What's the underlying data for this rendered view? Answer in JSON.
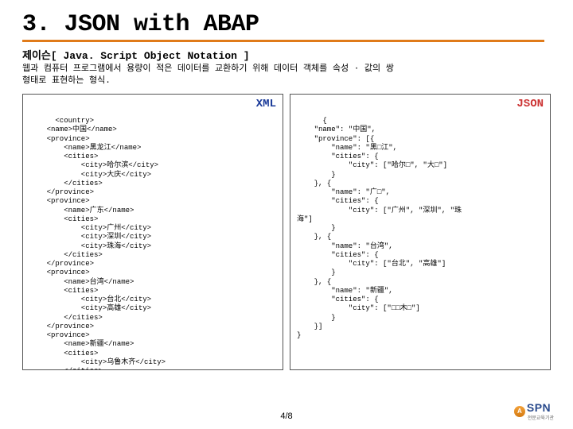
{
  "title": "3. JSON with ABAP",
  "subtitle": "제이슨[ Java. Script Object Notation ]",
  "description": "웹과 컴퓨터 프로그램에서 용량이 적은 데이터를 교환하기 위해 데이터 객체를 속성 · 값의 쌍\n형태로 표현하는 형식.",
  "labels": {
    "xml": "XML",
    "json": "JSON"
  },
  "xml_code": "<country>\n    <name>中国</name>\n    <province>\n        <name>黑龙江</name>\n        <cities>\n            <city>哈尔滨</city>\n            <city>大庆</city>\n        </cities>\n    </province>\n    <province>\n        <name>广东</name>\n        <cities>\n            <city>广州</city>\n            <city>深圳</city>\n            <city>珠海</city>\n        </cities>\n    </province>\n    <province>\n        <name>台湾</name>\n        <cities>\n            <city>台北</city>\n            <city>高雄</city>\n        </cities>\n    </province>\n    <province>\n        <name>新疆</name>\n        <cities>\n            <city>乌鲁木齐</city>\n        </cities>\n    </province>\n</country>",
  "json_code": "{\n    \"name\": \"中国\",\n    \"province\": [{\n        \"name\": \"黑□江\",\n        \"cities\": {\n            \"city\": [\"哈尔□\", \"大□\"]\n        }\n    }, {\n        \"name\": \"广□\",\n        \"cities\": {\n            \"city\": [\"广州\", \"深圳\", \"珠\n海\"]\n        }\n    }, {\n        \"name\": \"台湾\",\n        \"cities\": {\n            \"city\": [\"台北\", \"高雄\"]\n        }\n    }, {\n        \"name\": \"新疆\",\n        \"cities\": {\n            \"city\": [\"□□木□\"]\n        }\n    }]\n}",
  "pager": "4/8",
  "logo": {
    "letter": "A",
    "name": "SPN",
    "tagline": "전문교육기관"
  }
}
